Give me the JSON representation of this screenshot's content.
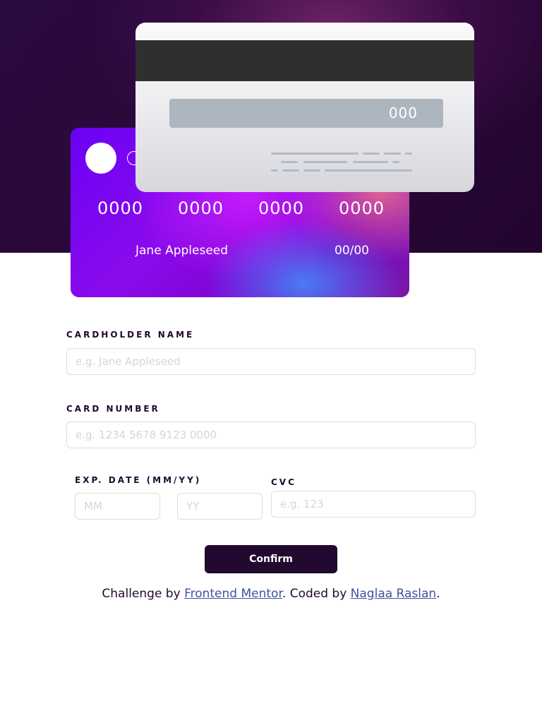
{
  "colors": {
    "hero_dark": "#22052f",
    "ink": "#21092f",
    "link": "#3e52a3",
    "input_border": "#dedddf",
    "placeholder": "#d6d4d8"
  },
  "card_back": {
    "cvc": "000"
  },
  "card_front": {
    "number_groups": [
      "0000",
      "0000",
      "0000",
      "0000"
    ],
    "holder_name": "Jane Appleseed",
    "expiry": "00/00"
  },
  "form": {
    "cardholder_label": "Cardholder Name",
    "cardholder_placeholder": "e.g. Jane Appleseed",
    "number_label": "Card Number",
    "number_placeholder": "e.g. 1234 5678 9123 0000",
    "exp_label": "Exp. Date (MM/YY)",
    "month_placeholder": "MM",
    "year_placeholder": "YY",
    "cvc_label": "CVC",
    "cvc_placeholder": "e.g. 123",
    "confirm_label": "Confirm"
  },
  "footer": {
    "prefix": "Challenge by ",
    "fm_link": "Frontend Mentor",
    "middle": ". Coded by ",
    "author_link": "Naglaa Raslan",
    "suffix": "."
  }
}
